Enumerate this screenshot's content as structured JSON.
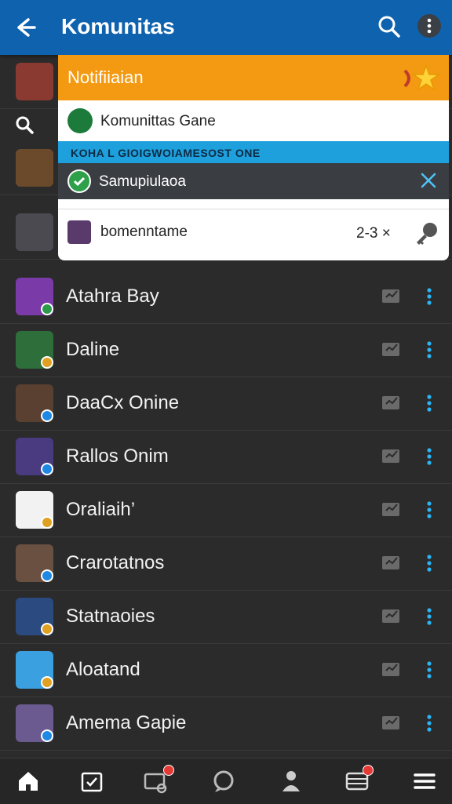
{
  "header": {
    "title": "Komunitas"
  },
  "notification_panel": {
    "title": "Notifiiaian",
    "item1": "Komunittas Gane",
    "band": "KOHA L GIOIGWOIAMESOST ONE",
    "item2": "Samupiulaoa",
    "item3": "bomenntame",
    "item3_count": "2-3 ×"
  },
  "list": [
    {
      "name": "Atahra Bay",
      "avatar": "#7a3aa8",
      "badge": "#2b9a4a"
    },
    {
      "name": "Daline",
      "avatar": "#2e6e3a",
      "badge": "#e0a020"
    },
    {
      "name": "DaaCx Onine",
      "avatar": "#5a4030",
      "badge": "#1e88e5"
    },
    {
      "name": "Rallos Onim",
      "avatar": "#4a3a80",
      "badge": "#1e88e5"
    },
    {
      "name": "Oraliaih’",
      "avatar": "#f2f2f2",
      "badge": "#e0a020"
    },
    {
      "name": "Crarotatnos",
      "avatar": "#6a5040",
      "badge": "#1e88e5"
    },
    {
      "name": "Statnaoies",
      "avatar": "#2a4a80",
      "badge": "#e0a020"
    },
    {
      "name": "Aloatand",
      "avatar": "#3aa0e0",
      "badge": "#e0a020"
    },
    {
      "name": "Amema Gapie",
      "avatar": "#6a5a90",
      "badge": "#1e88e5"
    }
  ],
  "colors": {
    "accent": "#1ea0dc",
    "appbar": "#0f62ae",
    "notif": "#f39a12"
  }
}
